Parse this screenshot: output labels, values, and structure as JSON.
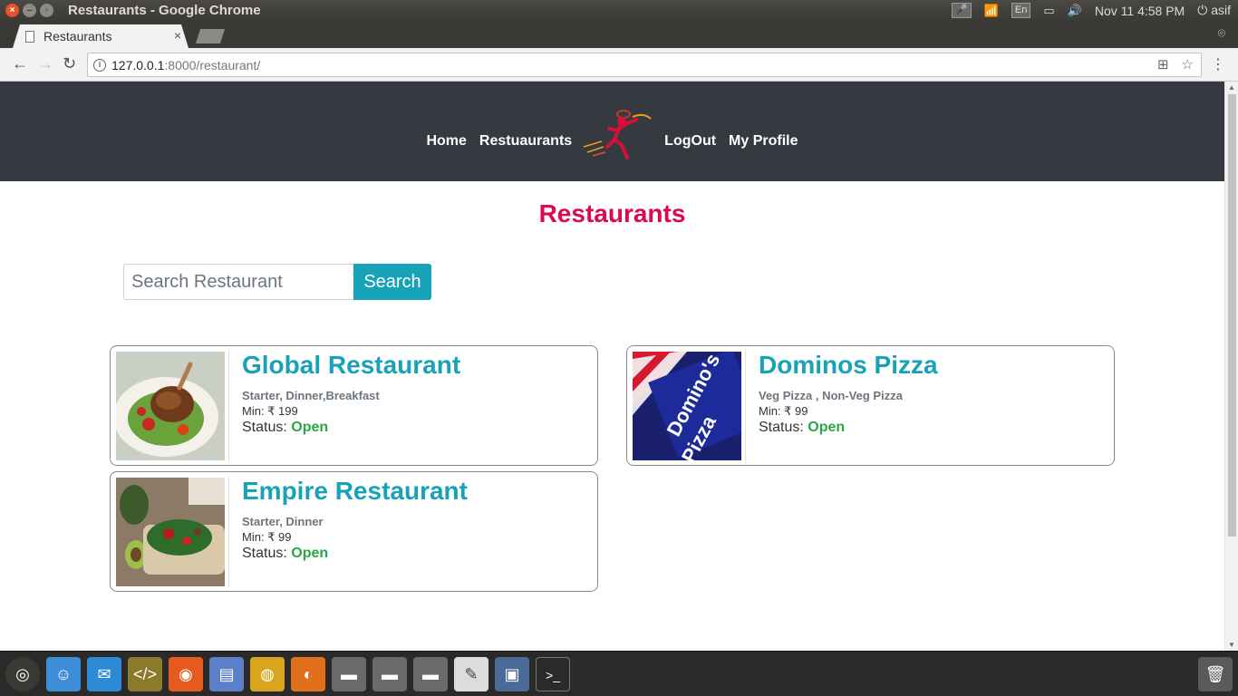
{
  "window": {
    "title": "Restaurants - Google Chrome",
    "close_glyph": "×",
    "min_glyph": "–",
    "max_glyph": "▫"
  },
  "system": {
    "keyboard": "En",
    "datetime": "Nov 11  4:58 PM",
    "user": "asif"
  },
  "browser": {
    "tab_title": "Restaurants",
    "tab_close": "×",
    "url_host": "127.0.0.1",
    "url_rest": ":8000/restaurant/",
    "back": "←",
    "forward": "→",
    "reload": "↻",
    "menu": "⋮",
    "translate": "⊞",
    "bookmark": "☆"
  },
  "nav": {
    "home": "Home",
    "restaurants": "Restuaurants",
    "logout": "LogOut",
    "profile": "My Profile"
  },
  "page": {
    "title": "Restaurants"
  },
  "search": {
    "placeholder": "Search Restaurant",
    "button": "Search"
  },
  "restaurants": [
    {
      "name": "Global Restaurant",
      "categories": "Starter, Dinner,Breakfast",
      "min": "Min: ₹ 199",
      "status_label": "Status:",
      "status": "Open"
    },
    {
      "name": "Dominos Pizza",
      "categories": "Veg Pizza , Non-Veg Pizza",
      "min": "Min: ₹ 99",
      "status_label": "Status:",
      "status": "Open"
    },
    {
      "name": "Empire Restaurant",
      "categories": "Starter, Dinner",
      "min": "Min: ₹ 99",
      "status_label": "Status:",
      "status": "Open"
    }
  ],
  "dominos_logo_text": [
    "Domino's",
    "Pizza"
  ],
  "colors": {
    "header_bg": "#343a40",
    "title": "#dc0a4b",
    "accent": "#17a2b8",
    "open": "#28a745"
  },
  "dock_icons": [
    "ubuntu-icon",
    "finder-icon",
    "mail-icon",
    "code-editor-icon",
    "software-center-icon",
    "files-icon",
    "chrome-icon",
    "firefox-icon",
    "drive-icon",
    "drive-icon",
    "drive-icon",
    "text-editor-icon",
    "screenshot-icon",
    "terminal-icon",
    "trash-icon"
  ]
}
